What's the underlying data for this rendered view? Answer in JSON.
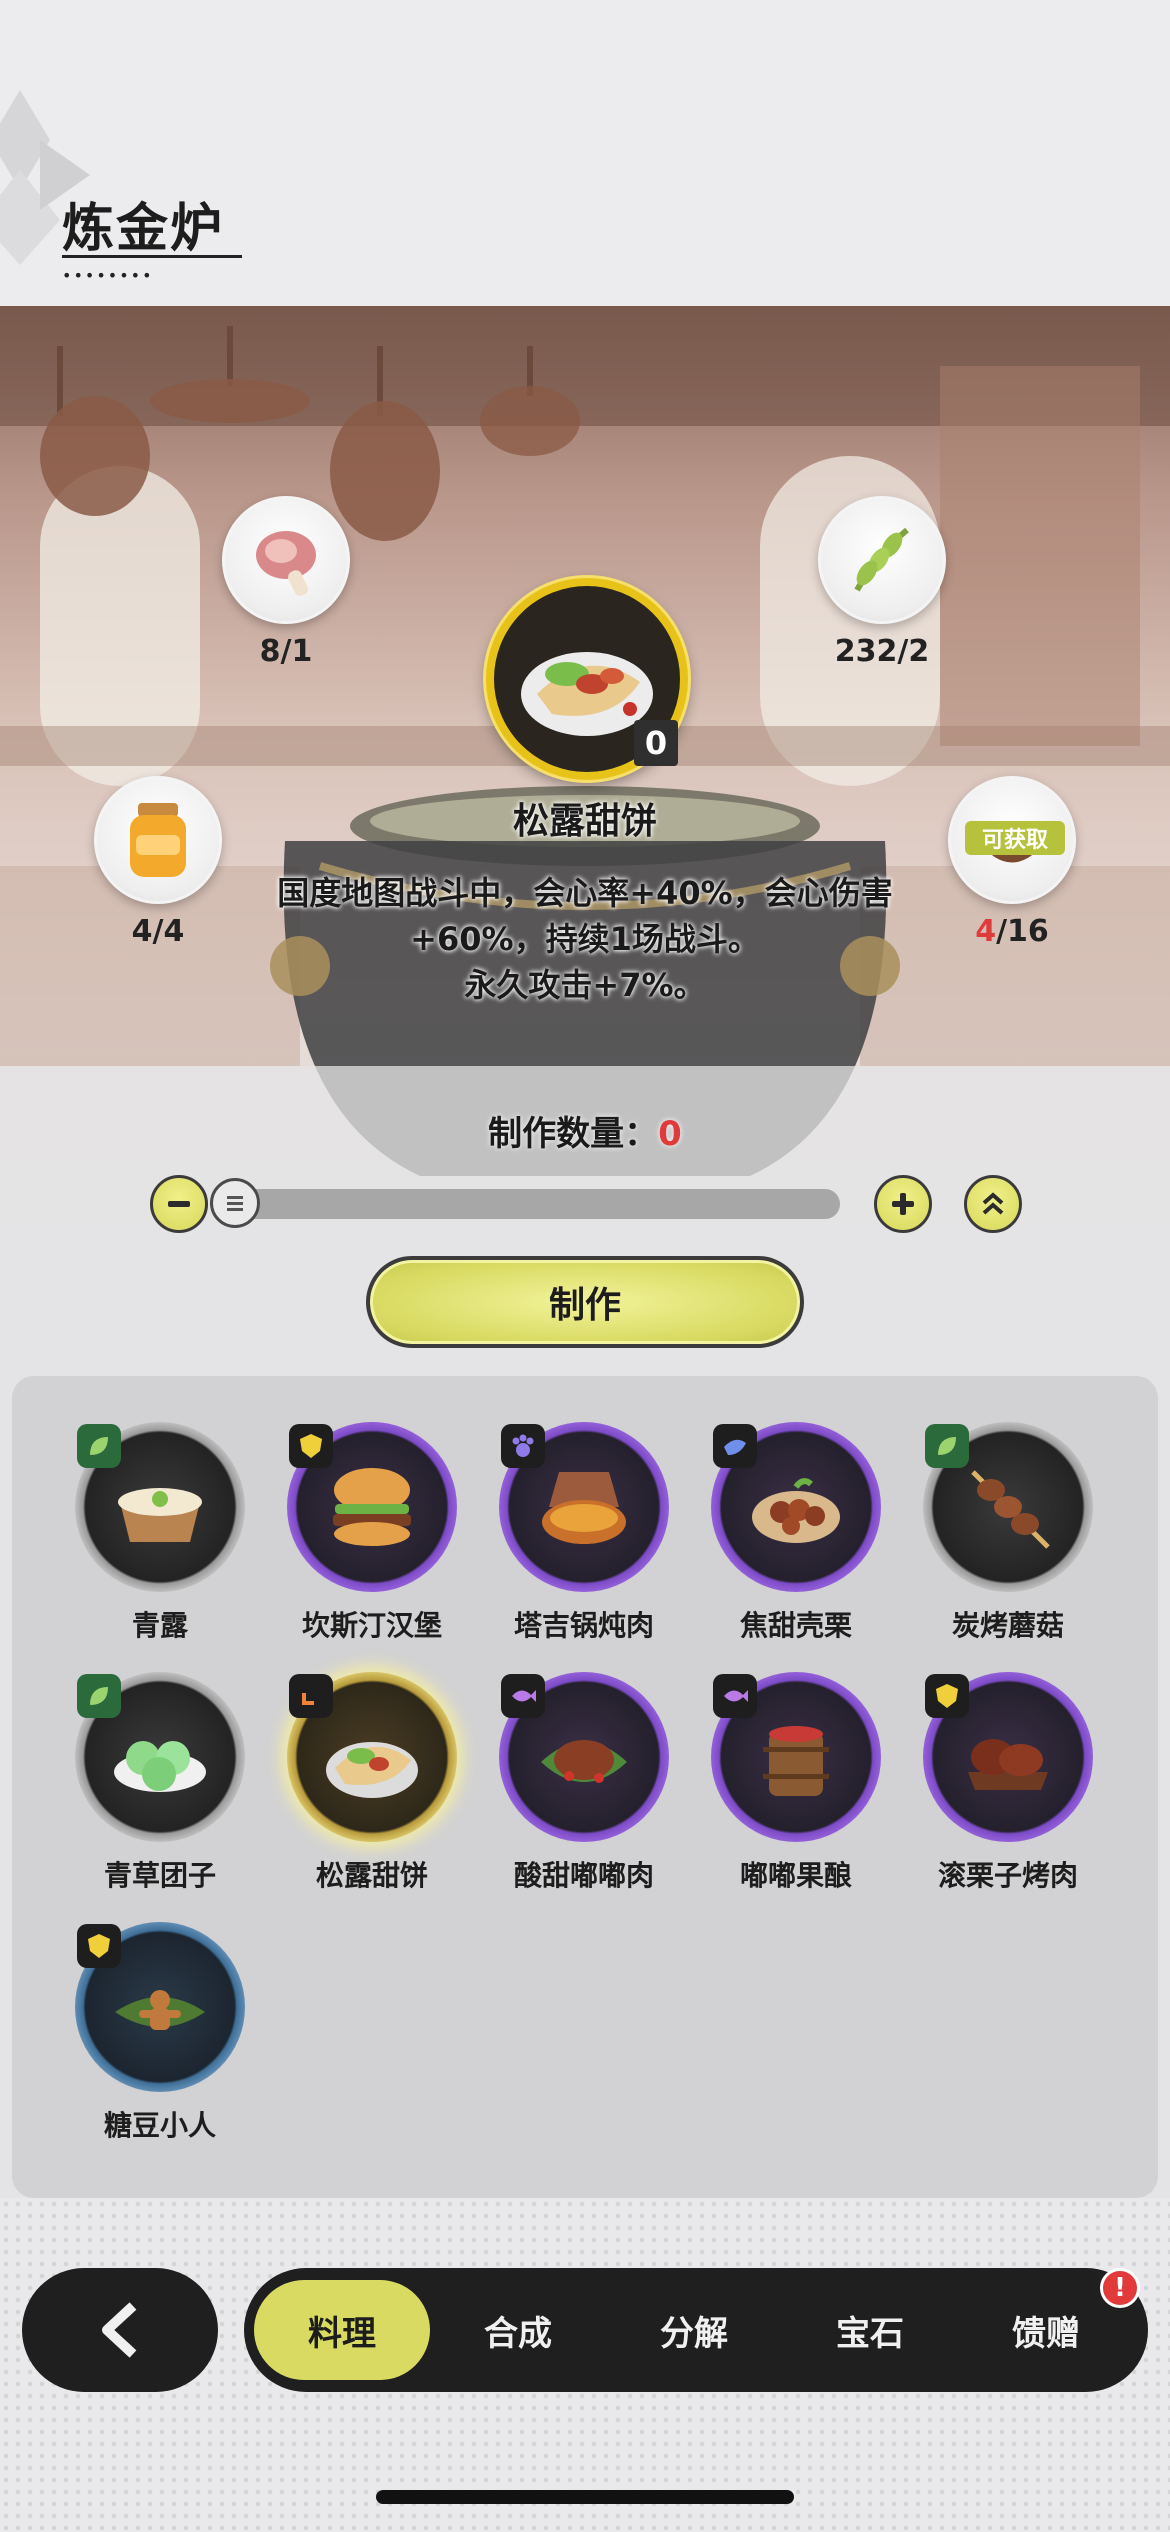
{
  "header": {
    "title": "炼金炉"
  },
  "ingredients": [
    {
      "name": "ham-icon",
      "count": "8/1"
    },
    {
      "name": "wheat-icon",
      "count": "232/2"
    },
    {
      "name": "honey-jar-icon",
      "count": "4/4"
    },
    {
      "name": "mushroom-bowl-icon",
      "count_have": "4",
      "count_need": "/16",
      "tag": "可获取"
    }
  ],
  "selected_dish": {
    "name": "松露甜饼",
    "owned": "0",
    "description_line1": "国度地图战斗中，会心率+40%，会心伤害",
    "description_line2": "+60%，持续1场战斗。",
    "description_line3": "永久攻击+7%。"
  },
  "quantity": {
    "label": "制作数量：",
    "value": "0",
    "progress": 0
  },
  "make_button": {
    "label": "制作"
  },
  "recipes": [
    {
      "label": "青露",
      "frame": "gray",
      "tag": "leaf"
    },
    {
      "label": "坎斯汀汉堡",
      "frame": "purple",
      "tag": "shield"
    },
    {
      "label": "塔吉锅炖肉",
      "frame": "purple",
      "tag": "paw"
    },
    {
      "label": "焦甜壳栗",
      "frame": "purple",
      "tag": "bird"
    },
    {
      "label": "炭烤蘑菇",
      "frame": "gray",
      "tag": "leaf"
    },
    {
      "label": "青草团子",
      "frame": "gray",
      "tag": "leaf"
    },
    {
      "label": "松露甜饼",
      "frame": "gold",
      "tag": "arrow"
    },
    {
      "label": "酸甜嘟嘟肉",
      "frame": "purple",
      "tag": "fish"
    },
    {
      "label": "嘟嘟果酿",
      "frame": "purple",
      "tag": "fish"
    },
    {
      "label": "滚栗子烤肉",
      "frame": "purple",
      "tag": "shield"
    },
    {
      "label": "糖豆小人",
      "frame": "blue",
      "tag": "shield"
    }
  ],
  "tabs": [
    {
      "label": "料理",
      "active": true
    },
    {
      "label": "合成",
      "active": false
    },
    {
      "label": "分解",
      "active": false
    },
    {
      "label": "宝石",
      "active": false
    },
    {
      "label": "馈赠",
      "active": false
    }
  ],
  "notification_badge": "!",
  "colors": {
    "accent": "#d8da62",
    "dark": "#1f1f1f",
    "alert": "#e03b3b",
    "selected_ring": "#e7c31a"
  }
}
